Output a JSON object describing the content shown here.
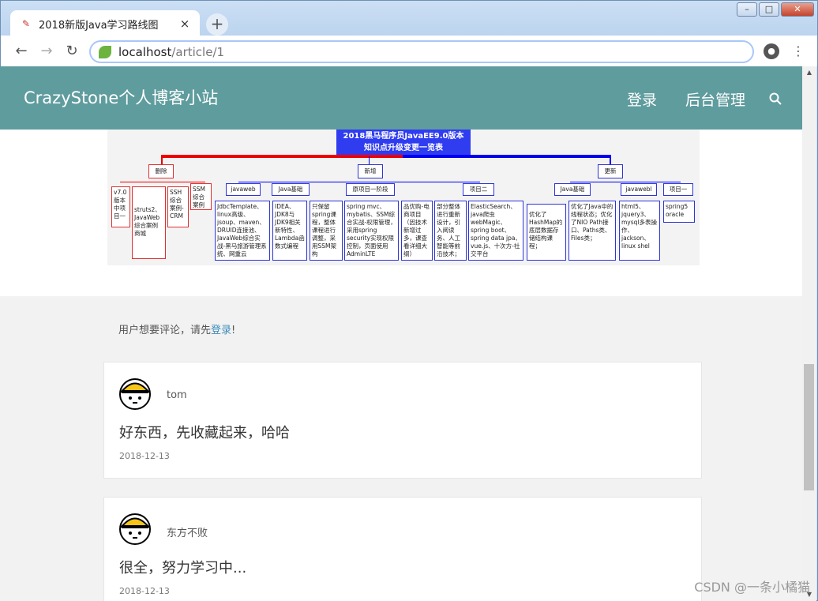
{
  "browser": {
    "tab_title": "2018新版Java学习路线图",
    "close_glyph": "×",
    "new_tab_glyph": "+",
    "url_host": "localhost",
    "url_path": "/article/1",
    "account_glyph": "●",
    "menu_glyph": "⋮"
  },
  "window_controls": {
    "minimize": "–",
    "maximize": "□",
    "close": "✕"
  },
  "site": {
    "brand": "CrazyStone个人博客小站",
    "nav": [
      "登录",
      "后台管理"
    ]
  },
  "mindmap": {
    "title_line1": "2018黑马程序员JavaEE9.0版本",
    "title_line2": "知识点升级变更一览表",
    "branches": {
      "delete": "删除",
      "add": "新增",
      "update": "更新"
    },
    "delete_items": [
      "v7.0版本中项目一",
      "struts2、JavaWeb综合案例商城",
      "SSH综合案例-CRM",
      "SSM综合案例"
    ],
    "add_categories": [
      "javaweb",
      "Java基础",
      "原项目一阶段",
      "项目二"
    ],
    "add_items": [
      "JdbcTemplate、linux高级、jsoup、maven、DRUID连接池、JavaWeb综合实战-黑马旅游管理系统、网重云",
      "IDEA、JDK8与JDK9相关新特性、Lambda函数式编程",
      "只保留spring课程，整体课程进行调整，采用SSM架构",
      "spring mvc、mybatis、SSM综合实战-权限管理，采用spring security实现权限控制，页面使用AdminLTE",
      "品优购-电商项目（因技术新增过多，课查看详细大纲）",
      "部分整体进行重新设计，引入阅读务、人工智能等前沿技术；",
      "ElasticSearch、java爬虫webMagic、spring boot、spring data jpa、vue.js、十次方-社交平台"
    ],
    "update_categories": [
      "Java基础",
      "javawebl",
      "项目一"
    ],
    "update_items": [
      "优化了HashMap的底层数据存储结构课程；",
      "优化了Java中的线程状态；优化了NIO Path接口、Paths类、Files类；",
      "html5、jquery3、mysql多表操作、jackson、linux shel",
      "spring5 oracle"
    ]
  },
  "comments": {
    "login_prefix": "用户想要评论，请先",
    "login_link": "登录",
    "login_suffix": "!",
    "items": [
      {
        "name": "tom",
        "text": "好东西，先收藏起来，哈哈",
        "date": "2018-12-13"
      },
      {
        "name": "东方不败",
        "text": "很全，努力学习中...",
        "date": "2018-12-13"
      }
    ]
  },
  "watermark": "CSDN @一条小橘猫",
  "colors": {
    "navbar": "#5f9c9e",
    "delete_branch": "#e03030",
    "add_branch": "#2d35d8",
    "link": "#3c8dbc"
  }
}
